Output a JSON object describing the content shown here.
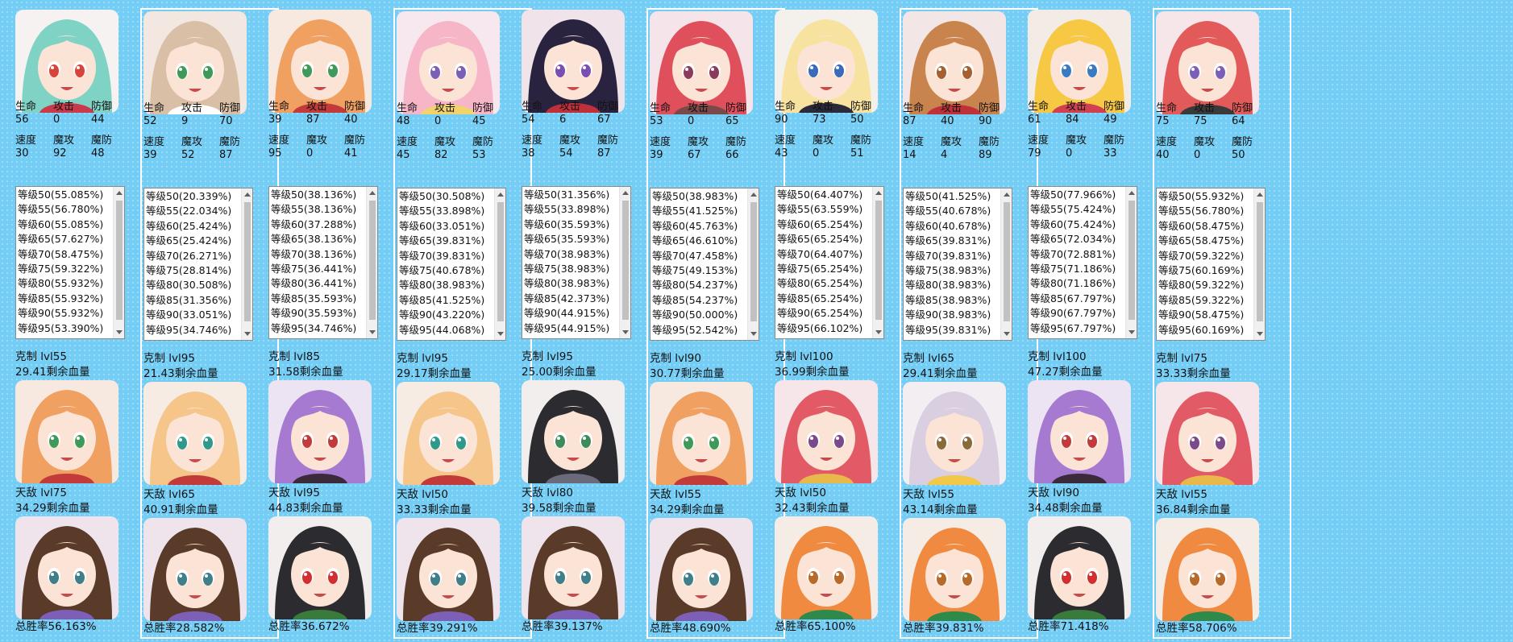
{
  "stat_labels": {
    "hp": "生命",
    "atk": "攻击",
    "def": "防御",
    "spd": "速度",
    "matk": "魔攻",
    "mdef": "魔防"
  },
  "cards": [
    {
      "framed": false,
      "hero": {
        "name": "green-hair-horned-girl",
        "hair": "#7fd3c4",
        "eye": "#d9443a",
        "bg": "#f6f2f2",
        "accent": "#c93b4a"
      },
      "stats": {
        "hp": "56",
        "atk": "0",
        "def": "44",
        "spd": "30",
        "matk": "92",
        "mdef": "48"
      },
      "levels": [
        "等级50(55.085%)",
        "等级55(56.780%)",
        "等级60(55.085%)",
        "等级65(57.627%)",
        "等级70(58.475%)",
        "等级75(59.322%)",
        "等级80(55.932%)",
        "等级85(55.932%)",
        "等级90(55.932%)",
        "等级95(53.390%)"
      ],
      "counter": {
        "label": "克制 lvl55",
        "hp": "29.41剩余血量",
        "hero": {
          "name": "orange-hair-ribbon-girl",
          "hair": "#f0a060",
          "eye": "#3f9a5a",
          "bg": "#f7e9e0",
          "accent": "#c23a3a"
        }
      },
      "nemesis": {
        "label": "天敌 lvl75",
        "hp": "34.29剩余血量",
        "hero": {
          "name": "brown-long-hair-girl",
          "hair": "#5a3a28",
          "eye": "#3f7f8a",
          "bg": "#efe4ec",
          "accent": "#7d5fb8"
        }
      },
      "winrate": "总胜率56.163%"
    },
    {
      "framed": true,
      "hero": {
        "name": "maid-light-brown-hair-girl",
        "hair": "#d9bfa6",
        "eye": "#3f9a5a",
        "bg": "#f3e7e1",
        "accent": "#ffffff"
      },
      "stats": {
        "hp": "52",
        "atk": "9",
        "def": "70",
        "spd": "39",
        "matk": "52",
        "mdef": "87"
      },
      "levels": [
        "等级50(20.339%)",
        "等级55(22.034%)",
        "等级60(25.424%)",
        "等级65(25.424%)",
        "等级70(26.271%)",
        "等级75(28.814%)",
        "等级80(30.508%)",
        "等级85(31.356%)",
        "等级90(33.051%)",
        "等级95(34.746%)"
      ],
      "counter": {
        "label": "克制 lvl95",
        "hp": "21.43剩余血量",
        "hero": {
          "name": "blonde-long-hair-girl",
          "hair": "#f5c58a",
          "eye": "#2f9a8a",
          "bg": "#f7ece4",
          "accent": "#c23a3a"
        }
      },
      "nemesis": {
        "label": "天敌 lvl65",
        "hp": "40.91剩余血量",
        "hero": {
          "name": "brown-long-hair-girl",
          "hair": "#5a3a28",
          "eye": "#3f7f8a",
          "bg": "#efe4ec",
          "accent": "#7d5fb8"
        }
      },
      "winrate": "总胜率28.582%"
    },
    {
      "framed": false,
      "hero": {
        "name": "orange-hair-ribbon-girl",
        "hair": "#f0a060",
        "eye": "#3f9a5a",
        "bg": "#f7e9e0",
        "accent": "#c23a3a"
      },
      "stats": {
        "hp": "39",
        "atk": "87",
        "def": "40",
        "spd": "95",
        "matk": "0",
        "mdef": "41"
      },
      "levels": [
        "等级50(38.136%)",
        "等级55(38.136%)",
        "等级60(37.288%)",
        "等级65(38.136%)",
        "等级70(38.136%)",
        "等级75(36.441%)",
        "等级80(36.441%)",
        "等级85(35.593%)",
        "等级90(35.593%)",
        "等级95(34.746%)"
      ],
      "counter": {
        "label": "克制 lvl85",
        "hp": "31.58剩余血量",
        "hero": {
          "name": "purple-hair-eyepatch-girl",
          "hair": "#a77ad1",
          "eye": "#c23a3a",
          "bg": "#ece4f2",
          "accent": "#3a2a3a"
        }
      },
      "nemesis": {
        "label": "天敌 lvl95",
        "hp": "44.83剩余血量",
        "hero": {
          "name": "black-hair-cat-girl",
          "hair": "#2b2b30",
          "eye": "#d23030",
          "bg": "#f2eeee",
          "accent": "#3a7a3a"
        }
      },
      "winrate": "总胜率36.672%"
    },
    {
      "framed": true,
      "hero": {
        "name": "pink-hair-elf-girl",
        "hair": "#f6b6c8",
        "eye": "#7a5fb8",
        "bg": "#f7e8ef",
        "accent": "#f2d36b"
      },
      "stats": {
        "hp": "48",
        "atk": "0",
        "def": "45",
        "spd": "45",
        "matk": "82",
        "mdef": "53"
      },
      "levels": [
        "等级50(30.508%)",
        "等级55(33.898%)",
        "等级60(33.051%)",
        "等级65(39.831%)",
        "等级70(39.831%)",
        "等级75(40.678%)",
        "等级80(38.983%)",
        "等级85(41.525%)",
        "等级90(43.220%)",
        "等级95(44.068%)"
      ],
      "counter": {
        "label": "克制 lvl95",
        "hp": "29.17剩余血量",
        "hero": {
          "name": "blonde-long-hair-girl",
          "hair": "#f5c58a",
          "eye": "#2f9a8a",
          "bg": "#f7ece4",
          "accent": "#c23a3a"
        }
      },
      "nemesis": {
        "label": "天敌 lvl50",
        "hp": "33.33剩余血量",
        "hero": {
          "name": "brown-long-hair-girl",
          "hair": "#5a3a28",
          "eye": "#3f7f8a",
          "bg": "#efe4ec",
          "accent": "#7d5fb8"
        }
      },
      "winrate": "总胜率39.291%"
    },
    {
      "framed": false,
      "hero": {
        "name": "dark-hair-hime-girl",
        "hair": "#2a2340",
        "eye": "#7a4fb0",
        "bg": "#f0e4ea",
        "accent": "#c0303a"
      },
      "stats": {
        "hp": "54",
        "atk": "6",
        "def": "67",
        "spd": "38",
        "matk": "54",
        "mdef": "87"
      },
      "levels": [
        "等级50(31.356%)",
        "等级55(33.898%)",
        "等级60(35.593%)",
        "等级65(35.593%)",
        "等级70(38.983%)",
        "等级75(38.983%)",
        "等级80(38.983%)",
        "等级85(42.373%)",
        "等级90(44.915%)",
        "等级95(44.915%)"
      ],
      "counter": {
        "label": "克制 lvl95",
        "hp": "25.00剩余血量",
        "hero": {
          "name": "black-hair-cat-girl-sunglasses",
          "hair": "#2b2b30",
          "eye": "#3f8a5a",
          "bg": "#f2eeee",
          "accent": "#6a6a7a"
        }
      },
      "nemesis": {
        "label": "天敌 lvl80",
        "hp": "39.58剩余血量",
        "hero": {
          "name": "brown-long-hair-girl",
          "hair": "#5a3a28",
          "eye": "#3f7f8a",
          "bg": "#efe4ec",
          "accent": "#7d5fb8"
        }
      },
      "winrate": "总胜率39.137%"
    },
    {
      "framed": true,
      "hero": {
        "name": "red-hair-horned-girl",
        "hair": "#e0505c",
        "eye": "#8a3a5a",
        "bg": "#f5e4ea",
        "accent": "#7a4a4a"
      },
      "stats": {
        "hp": "53",
        "atk": "0",
        "def": "65",
        "spd": "39",
        "matk": "67",
        "mdef": "66"
      },
      "levels": [
        "等级50(38.983%)",
        "等级55(41.525%)",
        "等级60(45.763%)",
        "等级65(46.610%)",
        "等级70(47.458%)",
        "等级75(49.153%)",
        "等级80(54.237%)",
        "等级85(54.237%)",
        "等级90(50.000%)",
        "等级95(52.542%)"
      ],
      "counter": {
        "label": "克制 lvl90",
        "hp": "30.77剩余血量",
        "hero": {
          "name": "orange-hair-ribbon-girl",
          "hair": "#f0a060",
          "eye": "#3f9a5a",
          "bg": "#f7e9e0",
          "accent": "#c23a3a"
        }
      },
      "nemesis": {
        "label": "天敌 lvl55",
        "hp": "34.29剩余血量",
        "hero": {
          "name": "brown-long-hair-girl",
          "hair": "#5a3a28",
          "eye": "#3f7f8a",
          "bg": "#efe4ec",
          "accent": "#7d5fb8"
        }
      },
      "winrate": "总胜率48.690%"
    },
    {
      "framed": false,
      "hero": {
        "name": "blonde-hair-bow-girl",
        "hair": "#f7e2a0",
        "eye": "#3a6ab8",
        "bg": "#f4f0ec",
        "accent": "#2a2a3a"
      },
      "stats": {
        "hp": "90",
        "atk": "73",
        "def": "50",
        "spd": "43",
        "matk": "0",
        "mdef": "51"
      },
      "levels": [
        "等级50(64.407%)",
        "等级55(63.559%)",
        "等级60(65.254%)",
        "等级65(65.254%)",
        "等级70(64.407%)",
        "等级75(65.254%)",
        "等级80(65.254%)",
        "等级85(65.254%)",
        "等级90(65.254%)",
        "等级95(66.102%)"
      ],
      "counter": {
        "label": "克制 lvl100",
        "hp": "36.99剩余血量",
        "hero": {
          "name": "red-hair-girl",
          "hair": "#e25a66",
          "eye": "#7a4a8a",
          "bg": "#f6e6ea",
          "accent": "#e8b84a"
        }
      },
      "nemesis": {
        "label": "天敌 lvl50",
        "hp": "32.43剩余血量",
        "hero": {
          "name": "orange-hair-headphone-girl",
          "hair": "#f08a40",
          "eye": "#b86a2a",
          "bg": "#f6ece6",
          "accent": "#2e8a4a"
        }
      },
      "winrate": "总胜率65.100%"
    },
    {
      "framed": true,
      "hero": {
        "name": "brown-hair-maid-girl",
        "hair": "#c9844e",
        "eye": "#a5602f",
        "bg": "#f3e6e6",
        "accent": "#c0303a"
      },
      "stats": {
        "hp": "87",
        "atk": "40",
        "def": "90",
        "spd": "14",
        "matk": "4",
        "mdef": "89"
      },
      "levels": [
        "等级50(41.525%)",
        "等级55(40.678%)",
        "等级60(40.678%)",
        "等级65(39.831%)",
        "等级70(39.831%)",
        "等级75(38.983%)",
        "等级80(38.983%)",
        "等级85(38.983%)",
        "等级90(38.983%)",
        "等级95(39.831%)"
      ],
      "counter": {
        "label": "克制 lvl65",
        "hp": "29.41剩余血量",
        "hero": {
          "name": "silver-hair-hat-girl",
          "hair": "#d9cfe0",
          "eye": "#8a6a3a",
          "bg": "#f2eef2",
          "accent": "#f2c84a"
        }
      },
      "nemesis": {
        "label": "天敌 lvl55",
        "hp": "43.14剩余血量",
        "hero": {
          "name": "orange-hair-headphone-girl",
          "hair": "#f08a40",
          "eye": "#b86a2a",
          "bg": "#f6ece6",
          "accent": "#2e8a4a"
        }
      },
      "winrate": "总胜率39.831%"
    },
    {
      "framed": false,
      "hero": {
        "name": "blonde-hair-flower-girl",
        "hair": "#f6c844",
        "eye": "#3a7ac0",
        "bg": "#f3ece6",
        "accent": "#d04050"
      },
      "stats": {
        "hp": "61",
        "atk": "84",
        "def": "49",
        "spd": "79",
        "matk": "0",
        "mdef": "33"
      },
      "levels": [
        "等级50(77.966%)",
        "等级55(75.424%)",
        "等级60(75.424%)",
        "等级65(72.034%)",
        "等级70(72.881%)",
        "等级75(71.186%)",
        "等级80(71.186%)",
        "等级85(67.797%)",
        "等级90(67.797%)",
        "等级95(67.797%)"
      ],
      "counter": {
        "label": "克制 lvl100",
        "hp": "47.27剩余血量",
        "hero": {
          "name": "purple-hair-eyepatch-girl",
          "hair": "#a77ad1",
          "eye": "#c23a3a",
          "bg": "#ece4f2",
          "accent": "#3a2a3a"
        }
      },
      "nemesis": {
        "label": "天敌 lvl90",
        "hp": "34.48剩余血量",
        "hero": {
          "name": "black-hair-cat-girl",
          "hair": "#2b2b30",
          "eye": "#d23030",
          "bg": "#f2eeee",
          "accent": "#3a7a3a"
        }
      },
      "winrate": "总胜率71.418%"
    },
    {
      "framed": true,
      "hero": {
        "name": "red-hair-choker-girl",
        "hair": "#e25a5a",
        "eye": "#7a5fb8",
        "bg": "#f6e6ea",
        "accent": "#3a3a3a"
      },
      "stats": {
        "hp": "75",
        "atk": "75",
        "def": "64",
        "spd": "40",
        "matk": "0",
        "mdef": "50"
      },
      "levels": [
        "等级50(55.932%)",
        "等级55(56.780%)",
        "等级60(58.475%)",
        "等级65(58.475%)",
        "等级70(59.322%)",
        "等级75(60.169%)",
        "等级80(59.322%)",
        "等级85(59.322%)",
        "等级90(58.475%)",
        "等级95(60.169%)"
      ],
      "counter": {
        "label": "克制 lvl75",
        "hp": "33.33剩余血量",
        "hero": {
          "name": "red-hair-girl",
          "hair": "#e25a66",
          "eye": "#7a4a8a",
          "bg": "#f6e6ea",
          "accent": "#e8b84a"
        }
      },
      "nemesis": {
        "label": "天敌 lvl55",
        "hp": "36.84剩余血量",
        "hero": {
          "name": "orange-hair-headphone-girl",
          "hair": "#f08a40",
          "eye": "#b86a2a",
          "bg": "#f6ece6",
          "accent": "#2e8a4a"
        }
      },
      "winrate": "总胜率58.706%"
    }
  ]
}
